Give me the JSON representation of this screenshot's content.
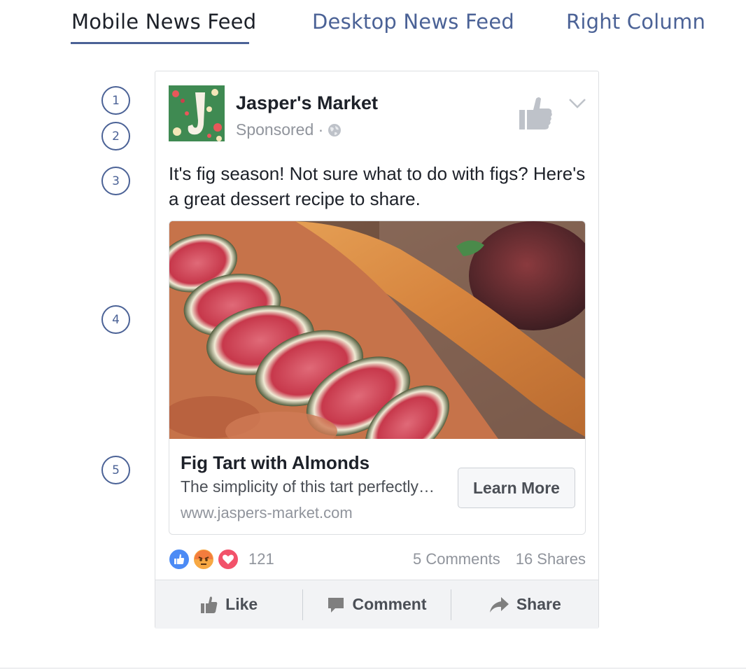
{
  "tabs": [
    {
      "label": "Mobile News Feed",
      "active": true
    },
    {
      "label": "Desktop News Feed",
      "active": false
    },
    {
      "label": "Right Column",
      "active": false
    }
  ],
  "markers": [
    "1",
    "2",
    "3",
    "4",
    "5"
  ],
  "post": {
    "page_name": "Jasper's Market",
    "sponsored": "Sponsored ·",
    "text": "It's fig season! Not sure what to do with figs? Here's a great dessert recipe to share."
  },
  "ad": {
    "headline": "Fig Tart with Almonds",
    "description": "The simplicity of this tart perfectly…",
    "url": "www.jaspers-market.com",
    "cta": "Learn More"
  },
  "engagement": {
    "reaction_count": "121",
    "comments": "5 Comments",
    "shares": "16 Shares"
  },
  "actions": {
    "like": "Like",
    "comment": "Comment",
    "share": "Share"
  },
  "colors": {
    "accent": "#4b6296",
    "avatar_bg": "#3f8a52"
  },
  "icons": [
    "globe-icon",
    "thumbs-up-icon",
    "chevron-down-icon",
    "like-reaction-icon",
    "angry-reaction-icon",
    "love-reaction-icon",
    "comment-icon",
    "share-arrow-icon"
  ]
}
